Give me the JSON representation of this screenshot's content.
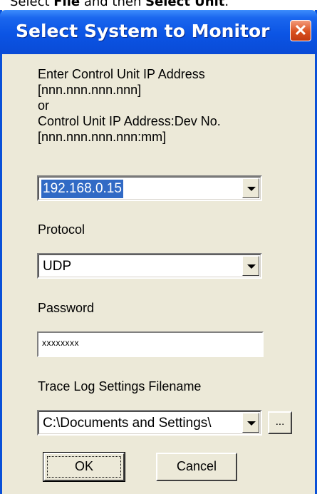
{
  "caption": {
    "prefix": "Select ",
    "file_word": "File",
    "middle": " and then ",
    "unit_word": "Select Unit",
    "suffix": "."
  },
  "dialog": {
    "title": "Select System to Monitor",
    "close_symbol": "✕"
  },
  "instructions": {
    "line1": "Enter Control Unit IP Address",
    "line2": "[nnn.nnn.nnn.nnn]",
    "line3": "or",
    "line4": "Control Unit IP Address:Dev No.",
    "line5": "[nnn.nnn.nnn.nnn:mm]"
  },
  "ip_combo": {
    "value": "192.168.0.15"
  },
  "protocol": {
    "label": "Protocol",
    "value": "UDP"
  },
  "password": {
    "label": "Password",
    "masked_value": "xxxxxxxx"
  },
  "trace_log": {
    "label": "Trace Log Settings Filename",
    "value": "C:\\Documents and Settings\\",
    "browse_label": "..."
  },
  "buttons": {
    "ok": "OK",
    "cancel": "Cancel"
  },
  "icons": {
    "dropdown": "chevron-down-icon",
    "close": "close-icon"
  },
  "colors": {
    "titlebar": "#0b54e4",
    "selection": "#316ac5",
    "dialog_face": "#ece9d8",
    "close_button": "#d9501f"
  }
}
